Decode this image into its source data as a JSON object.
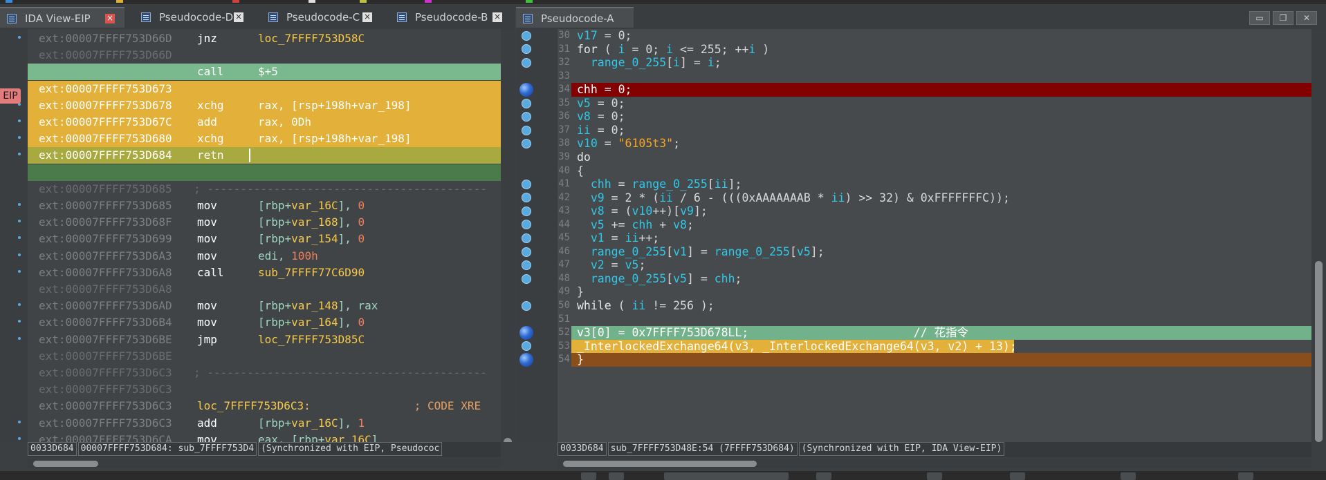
{
  "colors": {
    "accent_red_tab": "#d9534f",
    "eip_highlight": "#7ab98d",
    "trace_yellow": "#e3b13a",
    "bp_red": "#820000",
    "keyword": "#e8e8e8",
    "number": "#f07f5a",
    "variable": "#2ec8e8",
    "string": "#f5a623",
    "label_yellow": "#f7c948",
    "comment": "#e0c060"
  },
  "left_tabs": [
    {
      "label": "IDA View-EIP",
      "icon": "ida-view-icon",
      "close": "red"
    },
    {
      "label": "Pseudocode-D",
      "icon": "pseudocode-icon",
      "close": "grey"
    },
    {
      "label": "Pseudocode-C",
      "icon": "pseudocode-icon",
      "close": "grey"
    },
    {
      "label": "Pseudocode-B",
      "icon": "pseudocode-icon",
      "close": "grey"
    }
  ],
  "right_tab": {
    "label": "Pseudocode-A",
    "icon": "pseudocode-icon"
  },
  "eip_badge": "EIP",
  "asm_rows": [
    {
      "addr": "ext:00007FFFF753D66D",
      "mn": "jnz",
      "ops": [
        {
          "t": "loc_7FFFF753D58C",
          "c": "#f7c948"
        }
      ],
      "dot": true
    },
    {
      "addr": "ext:00007FFFF753D66D",
      "mn": "",
      "ops": [],
      "dim": true
    },
    {
      "addr": "ext:00007FFFF753D673",
      "mn": "call",
      "ops": [
        {
          "t": "$+5",
          "c": "#ffffff"
        }
      ],
      "hl": "green"
    },
    {
      "addr": "ext:00007FFFF753D673",
      "mn": "",
      "ops": [],
      "hl": "yellow"
    },
    {
      "addr": "ext:00007FFFF753D678",
      "mn": "xchg",
      "ops": [
        {
          "t": "rax, [rsp+198h+var_198]",
          "c": "#ffffff"
        }
      ],
      "hl": "yellow",
      "dot": true
    },
    {
      "addr": "ext:00007FFFF753D67C",
      "mn": "add",
      "ops": [
        {
          "t": "rax, 0Dh",
          "c": "#ffffff"
        }
      ],
      "hl": "yellow",
      "dot": true
    },
    {
      "addr": "ext:00007FFFF753D680",
      "mn": "xchg",
      "ops": [
        {
          "t": "rax, [rsp+198h+var_198]",
          "c": "#ffffff"
        }
      ],
      "hl": "yellow",
      "dot": true
    },
    {
      "addr": "ext:00007FFFF753D684",
      "mn": "retn",
      "ops": [],
      "hl": "olive",
      "dot": true
    },
    {
      "addr": "ext:00007FFFF753D684",
      "mn": "",
      "ops": [],
      "hl": "dkgreen"
    },
    {
      "addr": "ext:00007FFFF753D685",
      "mn": "; ------------------------------------------",
      "ops": [],
      "dim": true,
      "sep": true
    },
    {
      "addr": "ext:00007FFFF753D685",
      "mn": "mov",
      "ops": [
        {
          "t": "[rbp+",
          "c": "#9fd8c0"
        },
        {
          "t": "var_16C",
          "c": "#f7c948"
        },
        {
          "t": "], ",
          "c": "#9fd8c0"
        },
        {
          "t": "0",
          "c": "#f07f5a"
        }
      ],
      "dot": true
    },
    {
      "addr": "ext:00007FFFF753D68F",
      "mn": "mov",
      "ops": [
        {
          "t": "[rbp+",
          "c": "#9fd8c0"
        },
        {
          "t": "var_168",
          "c": "#f7c948"
        },
        {
          "t": "], ",
          "c": "#9fd8c0"
        },
        {
          "t": "0",
          "c": "#f07f5a"
        }
      ],
      "dot": true
    },
    {
      "addr": "ext:00007FFFF753D699",
      "mn": "mov",
      "ops": [
        {
          "t": "[rbp+",
          "c": "#9fd8c0"
        },
        {
          "t": "var_154",
          "c": "#f7c948"
        },
        {
          "t": "], ",
          "c": "#9fd8c0"
        },
        {
          "t": "0",
          "c": "#f07f5a"
        }
      ],
      "dot": true
    },
    {
      "addr": "ext:00007FFFF753D6A3",
      "mn": "mov",
      "ops": [
        {
          "t": "edi, ",
          "c": "#9fd8c0"
        },
        {
          "t": "100h",
          "c": "#f07f5a"
        }
      ],
      "dot": true
    },
    {
      "addr": "ext:00007FFFF753D6A8",
      "mn": "call",
      "ops": [
        {
          "t": "sub_7FFFF77C6D90",
          "c": "#f7c948"
        }
      ],
      "dot": true
    },
    {
      "addr": "ext:00007FFFF753D6A8",
      "mn": "",
      "ops": [],
      "dim": true
    },
    {
      "addr": "ext:00007FFFF753D6AD",
      "mn": "mov",
      "ops": [
        {
          "t": "[rbp+",
          "c": "#9fd8c0"
        },
        {
          "t": "var_148",
          "c": "#f7c948"
        },
        {
          "t": "], rax",
          "c": "#9fd8c0"
        }
      ],
      "dot": true
    },
    {
      "addr": "ext:00007FFFF753D6B4",
      "mn": "mov",
      "ops": [
        {
          "t": "[rbp+",
          "c": "#9fd8c0"
        },
        {
          "t": "var_164",
          "c": "#f7c948"
        },
        {
          "t": "], ",
          "c": "#9fd8c0"
        },
        {
          "t": "0",
          "c": "#f07f5a"
        }
      ],
      "dot": true
    },
    {
      "addr": "ext:00007FFFF753D6BE",
      "mn": "jmp",
      "ops": [
        {
          "t": "loc_7FFFF753D85C",
          "c": "#f7c948"
        }
      ],
      "dot": true
    },
    {
      "addr": "ext:00007FFFF753D6BE",
      "mn": "",
      "ops": [],
      "dim": true
    },
    {
      "addr": "ext:00007FFFF753D6C3",
      "mn": "; ------------------------------------------",
      "ops": [],
      "dim": true,
      "sep": true
    },
    {
      "addr": "ext:00007FFFF753D6C3",
      "mn": "",
      "ops": [],
      "dim": true
    },
    {
      "addr": "ext:00007FFFF753D6C3",
      "mn": "loc_7FFFF753D6C3:",
      "ops": [
        {
          "t": "                 ; CODE XRE",
          "c": "#e8a060"
        }
      ],
      "label": true
    },
    {
      "addr": "ext:00007FFFF753D6C3",
      "mn": "add",
      "ops": [
        {
          "t": "[rbp+",
          "c": "#9fd8c0"
        },
        {
          "t": "var_16C",
          "c": "#f7c948"
        },
        {
          "t": "], ",
          "c": "#9fd8c0"
        },
        {
          "t": "1",
          "c": "#f07f5a"
        }
      ],
      "dot": true
    },
    {
      "addr": "ext:00007FFFF753D6CA",
      "mn": "mov",
      "ops": [
        {
          "t": "eax, [rbp+",
          "c": "#9fd8c0"
        },
        {
          "t": "var_16C",
          "c": "#f7c948"
        },
        {
          "t": "]",
          "c": "#9fd8c0"
        }
      ],
      "dot": true
    }
  ],
  "left_status": [
    "0033D684",
    "00007FFFF753D684: sub_7FFFF753D4",
    "(Synchronized with EIP, Pseudococ"
  ],
  "code_rows": [
    {
      "ln": "30",
      "bp": "small",
      "parts": [
        {
          "t": "v17",
          "c": "#2ec8e8"
        },
        {
          "t": " = 0;",
          "c": "#d8d8d8"
        }
      ]
    },
    {
      "ln": "31",
      "bp": "small",
      "parts": [
        {
          "t": "for",
          "c": "#e8e8e8"
        },
        {
          "t": " ( ",
          "c": "#d8d8d8"
        },
        {
          "t": "i",
          "c": "#2ec8e8"
        },
        {
          "t": " = 0; ",
          "c": "#d8d8d8"
        },
        {
          "t": "i",
          "c": "#2ec8e8"
        },
        {
          "t": " <= 255; ++",
          "c": "#d8d8d8"
        },
        {
          "t": "i",
          "c": "#2ec8e8"
        },
        {
          "t": " )",
          "c": "#d8d8d8"
        }
      ]
    },
    {
      "ln": "32",
      "bp": "small",
      "parts": [
        {
          "t": "  range_0_255",
          "c": "#2ec8e8"
        },
        {
          "t": "[",
          "c": "#d8d8d8"
        },
        {
          "t": "i",
          "c": "#2ec8e8"
        },
        {
          "t": "] = ",
          "c": "#d8d8d8"
        },
        {
          "t": "i",
          "c": "#2ec8e8"
        },
        {
          "t": ";",
          "c": "#d8d8d8"
        }
      ]
    },
    {
      "ln": "33",
      "bp": "",
      "parts": []
    },
    {
      "ln": "34",
      "bp": "big",
      "hl": "red",
      "parts": [
        {
          "t": "chh",
          "c": "#ffffff"
        },
        {
          "t": " = 0;",
          "c": "#ffffff"
        }
      ]
    },
    {
      "ln": "35",
      "bp": "small",
      "parts": [
        {
          "t": "v5",
          "c": "#2ec8e8"
        },
        {
          "t": " = 0;",
          "c": "#d8d8d8"
        }
      ]
    },
    {
      "ln": "36",
      "bp": "small",
      "parts": [
        {
          "t": "v8",
          "c": "#2ec8e8"
        },
        {
          "t": " = 0;",
          "c": "#d8d8d8"
        }
      ]
    },
    {
      "ln": "37",
      "bp": "small",
      "parts": [
        {
          "t": "ii",
          "c": "#2ec8e8"
        },
        {
          "t": " = 0;",
          "c": "#d8d8d8"
        }
      ]
    },
    {
      "ln": "38",
      "bp": "small",
      "parts": [
        {
          "t": "v10",
          "c": "#2ec8e8"
        },
        {
          "t": " = ",
          "c": "#d8d8d8"
        },
        {
          "t": "\"6105t3\"",
          "c": "#f5a623"
        },
        {
          "t": ";",
          "c": "#d8d8d8"
        }
      ]
    },
    {
      "ln": "39",
      "bp": "",
      "parts": [
        {
          "t": "do",
          "c": "#e8e8e8"
        }
      ]
    },
    {
      "ln": "40",
      "bp": "",
      "parts": [
        {
          "t": "{",
          "c": "#d8d8d8"
        }
      ]
    },
    {
      "ln": "41",
      "bp": "small",
      "parts": [
        {
          "t": "  chh",
          "c": "#2ec8e8"
        },
        {
          "t": " = ",
          "c": "#d8d8d8"
        },
        {
          "t": "range_0_255",
          "c": "#2ec8e8"
        },
        {
          "t": "[",
          "c": "#d8d8d8"
        },
        {
          "t": "ii",
          "c": "#2ec8e8"
        },
        {
          "t": "];",
          "c": "#d8d8d8"
        }
      ]
    },
    {
      "ln": "42",
      "bp": "small",
      "parts": [
        {
          "t": "  v9",
          "c": "#2ec8e8"
        },
        {
          "t": " = 2 * (",
          "c": "#d8d8d8"
        },
        {
          "t": "ii",
          "c": "#2ec8e8"
        },
        {
          "t": " / 6 - (((0xAAAAAAAB * ",
          "c": "#d8d8d8"
        },
        {
          "t": "ii",
          "c": "#2ec8e8"
        },
        {
          "t": ") >> 32) & 0xFFFFFFFC));",
          "c": "#d8d8d8"
        }
      ]
    },
    {
      "ln": "43",
      "bp": "small",
      "parts": [
        {
          "t": "  v8",
          "c": "#2ec8e8"
        },
        {
          "t": " = (",
          "c": "#d8d8d8"
        },
        {
          "t": "v10",
          "c": "#2ec8e8"
        },
        {
          "t": "++)[",
          "c": "#d8d8d8"
        },
        {
          "t": "v9",
          "c": "#2ec8e8"
        },
        {
          "t": "];",
          "c": "#d8d8d8"
        }
      ]
    },
    {
      "ln": "44",
      "bp": "small",
      "parts": [
        {
          "t": "  v5",
          "c": "#2ec8e8"
        },
        {
          "t": " += ",
          "c": "#d8d8d8"
        },
        {
          "t": "chh",
          "c": "#2ec8e8"
        },
        {
          "t": " + ",
          "c": "#d8d8d8"
        },
        {
          "t": "v8",
          "c": "#2ec8e8"
        },
        {
          "t": ";",
          "c": "#d8d8d8"
        }
      ]
    },
    {
      "ln": "45",
      "bp": "small",
      "parts": [
        {
          "t": "  v1",
          "c": "#2ec8e8"
        },
        {
          "t": " = ",
          "c": "#d8d8d8"
        },
        {
          "t": "ii",
          "c": "#2ec8e8"
        },
        {
          "t": "++;",
          "c": "#d8d8d8"
        }
      ]
    },
    {
      "ln": "46",
      "bp": "small",
      "parts": [
        {
          "t": "  range_0_255",
          "c": "#2ec8e8"
        },
        {
          "t": "[",
          "c": "#d8d8d8"
        },
        {
          "t": "v1",
          "c": "#2ec8e8"
        },
        {
          "t": "] = ",
          "c": "#d8d8d8"
        },
        {
          "t": "range_0_255",
          "c": "#2ec8e8"
        },
        {
          "t": "[",
          "c": "#d8d8d8"
        },
        {
          "t": "v5",
          "c": "#2ec8e8"
        },
        {
          "t": "];",
          "c": "#d8d8d8"
        }
      ]
    },
    {
      "ln": "47",
      "bp": "small",
      "parts": [
        {
          "t": "  v2",
          "c": "#2ec8e8"
        },
        {
          "t": " = ",
          "c": "#d8d8d8"
        },
        {
          "t": "v5",
          "c": "#2ec8e8"
        },
        {
          "t": ";",
          "c": "#d8d8d8"
        }
      ]
    },
    {
      "ln": "48",
      "bp": "small",
      "parts": [
        {
          "t": "  range_0_255",
          "c": "#2ec8e8"
        },
        {
          "t": "[",
          "c": "#d8d8d8"
        },
        {
          "t": "v5",
          "c": "#2ec8e8"
        },
        {
          "t": "] = ",
          "c": "#d8d8d8"
        },
        {
          "t": "chh",
          "c": "#2ec8e8"
        },
        {
          "t": ";",
          "c": "#d8d8d8"
        }
      ]
    },
    {
      "ln": "49",
      "bp": "",
      "parts": [
        {
          "t": "}",
          "c": "#d8d8d8"
        }
      ]
    },
    {
      "ln": "50",
      "bp": "small",
      "parts": [
        {
          "t": "while",
          "c": "#e8e8e8"
        },
        {
          "t": " ( ",
          "c": "#d8d8d8"
        },
        {
          "t": "ii",
          "c": "#2ec8e8"
        },
        {
          "t": " != 256 );",
          "c": "#d8d8d8"
        }
      ]
    },
    {
      "ln": "51",
      "bp": "",
      "parts": []
    },
    {
      "ln": "52",
      "bp": "big",
      "hl": "green",
      "parts": [
        {
          "t": "v3[0] = 0x7FFFF753D678LL;                        // 花指令",
          "c": "#ffffff"
        }
      ]
    },
    {
      "ln": "53",
      "bp": "small",
      "hl": "yellow",
      "parts": [
        {
          "t": "_InterlockedExchange64(v3, _InterlockedExchange64(v3, v2) + 13);",
          "c": "#ffffff"
        }
      ]
    },
    {
      "ln": "54",
      "bp": "big",
      "hl": "brown",
      "parts": [
        {
          "t": "}",
          "c": "#ffffff"
        }
      ]
    }
  ],
  "right_status": [
    "0033D684",
    "sub_7FFFF753D48E:54 (7FFFF753D684)",
    "(Synchronized with EIP, IDA View-EIP)"
  ]
}
